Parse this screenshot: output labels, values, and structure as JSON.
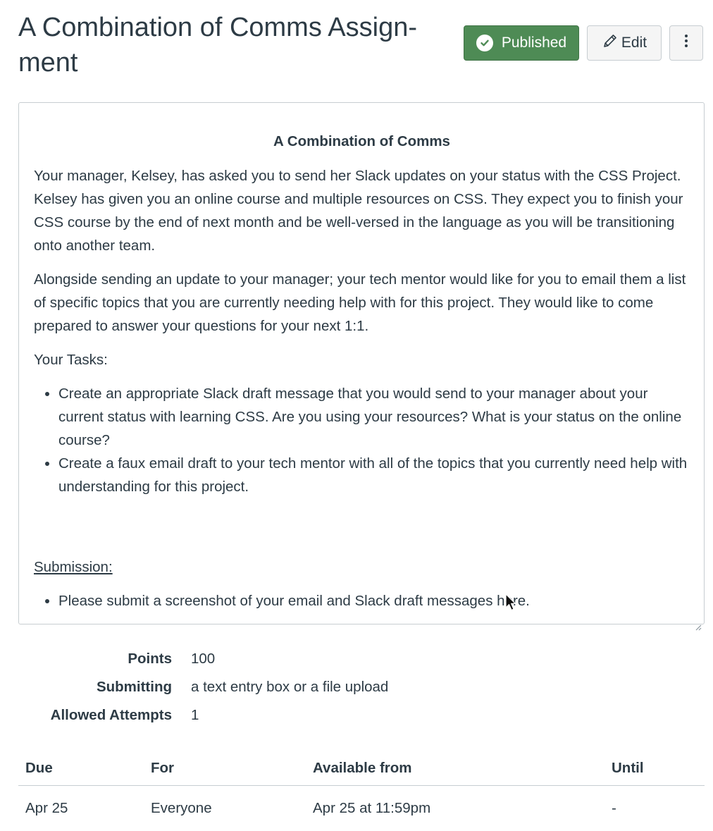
{
  "assignment": {
    "title": "A Combination of Comms Assign-\nment",
    "published_label": "Published",
    "edit_label": "Edit",
    "more_label": "⋮"
  },
  "description": {
    "heading": "A Combination of Comms",
    "paragraphs": [
      "Your manager, Kelsey, has asked you to send her Slack updates on your status with the CSS Project. Kelsey has given you an online course and multiple resources on CSS. They expect you to finish your CSS course by the end of next month and be well-versed in the language as you will be transitioning onto another team.",
      "Alongside sending an update to your manager; your tech mentor would like for you to email them a list of specific topics that you are currently needing help with for this project. They would like to come prepared to answer your questions for your next 1:1."
    ],
    "tasks_label": "Your Tasks:",
    "tasks": [
      "Create an appropriate Slack draft message that you would send to your manager about your current status with learning CSS. Are you using your resources? What is your status on the online course?",
      "Create a faux email draft to your tech mentor with all of the topics that you currently need help with understanding for this project."
    ],
    "submission_label": "Submission:",
    "submission_items": [
      "Please submit a screenshot of your email and Slack draft messages here."
    ]
  },
  "details": {
    "points_label": "Points",
    "points_value": "100",
    "submitting_label": "Submitting",
    "submitting_value": "a text entry box or a file upload",
    "attempts_label": "Allowed Attempts",
    "attempts_value": "1"
  },
  "dates": {
    "headers": [
      "Due",
      "For",
      "Available from",
      "Until"
    ],
    "rows": [
      [
        "Apr 25",
        "Everyone",
        "Apr 25 at 11:59pm",
        "-"
      ]
    ]
  },
  "colors": {
    "published_bg": "#4e8b55",
    "text": "#2d3b45",
    "border": "#c7cdd1"
  },
  "icons": {
    "published": "check-circle-icon",
    "edit": "pencil-icon",
    "more": "kebab-menu-icon",
    "resize": "resize-handle-icon",
    "cursor": "mouse-cursor-icon"
  }
}
